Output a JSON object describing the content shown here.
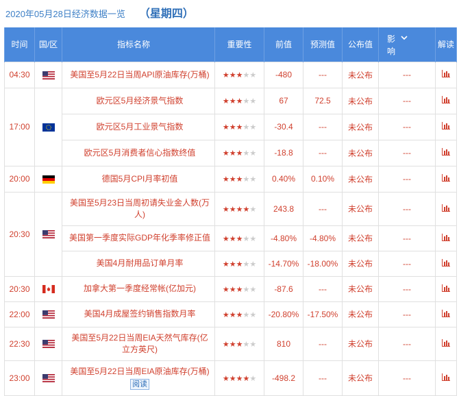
{
  "title": {
    "date_text": "2020年05月28日经济数据一览",
    "weekday": "（星期四）"
  },
  "columns": {
    "time": "时间",
    "region": "国/区",
    "indicator": "指标名称",
    "importance": "重要性",
    "previous": "前值",
    "forecast": "预测值",
    "actual": "公布值",
    "impact_line1": "影",
    "impact_line2": "响",
    "analysis": "解读"
  },
  "groups": [
    {
      "time": "04:30",
      "flag": "us-flag",
      "rows": [
        {
          "name": "美国至5月22日当周API原油库存(万桶)",
          "stars": 3,
          "prev": "-480",
          "forecast": "---",
          "actual": "未公布",
          "impact": "---"
        }
      ]
    },
    {
      "time": "17:00",
      "flag": "eu-flag",
      "rows": [
        {
          "name": "欧元区5月经济景气指数",
          "stars": 3,
          "prev": "67",
          "forecast": "72.5",
          "actual": "未公布",
          "impact": "---"
        },
        {
          "name": "欧元区5月工业景气指数",
          "stars": 3,
          "prev": "-30.4",
          "forecast": "---",
          "actual": "未公布",
          "impact": "---"
        },
        {
          "name": "欧元区5月消费者信心指数终值",
          "stars": 3,
          "prev": "-18.8",
          "forecast": "---",
          "actual": "未公布",
          "impact": "---"
        }
      ]
    },
    {
      "time": "20:00",
      "flag": "de-flag",
      "rows": [
        {
          "name": "德国5月CPI月率初值",
          "stars": 3,
          "prev": "0.40%",
          "forecast": "0.10%",
          "actual": "未公布",
          "impact": "---"
        }
      ]
    },
    {
      "time": "20:30",
      "flag": "us-flag",
      "rows": [
        {
          "name": "美国至5月23日当周初请失业金人数(万人)",
          "stars": 4,
          "prev": "243.8",
          "forecast": "---",
          "actual": "未公布",
          "impact": "---"
        },
        {
          "name": "美国第一季度实际GDP年化季率修正值",
          "stars": 3,
          "prev": "-4.80%",
          "forecast": "-4.80%",
          "actual": "未公布",
          "impact": "---"
        },
        {
          "name": "美国4月耐用品订单月率",
          "stars": 3,
          "prev": "-14.70%",
          "forecast": "-18.00%",
          "actual": "未公布",
          "impact": "---"
        }
      ]
    },
    {
      "time": "20:30",
      "flag": "ca-flag",
      "rows": [
        {
          "name": "加拿大第一季度经常帐(亿加元)",
          "stars": 3,
          "prev": "-87.6",
          "forecast": "---",
          "actual": "未公布",
          "impact": "---"
        }
      ]
    },
    {
      "time": "22:00",
      "flag": "us-flag",
      "rows": [
        {
          "name": "美国4月成屋签约销售指数月率",
          "stars": 3,
          "prev": "-20.80%",
          "forecast": "-17.50%",
          "actual": "未公布",
          "impact": "---"
        }
      ]
    },
    {
      "time": "22:30",
      "flag": "us-flag",
      "rows": [
        {
          "name": "美国至5月22日当周EIA天然气库存(亿立方英尺)",
          "stars": 3,
          "prev": "810",
          "forecast": "---",
          "actual": "未公布",
          "impact": "---"
        }
      ]
    },
    {
      "time": "23:00",
      "flag": "us-flag",
      "rows": [
        {
          "name": "美国至5月22日当周EIA原油库存(万桶)",
          "stars": 4,
          "prev": "-498.2",
          "forecast": "---",
          "actual": "未公布",
          "impact": "---",
          "read_label": "阅读"
        }
      ]
    }
  ],
  "colors": {
    "header_bg": "#4a89dc",
    "accent_red": "#d0402e",
    "title_blue": "#3d7fc6"
  }
}
